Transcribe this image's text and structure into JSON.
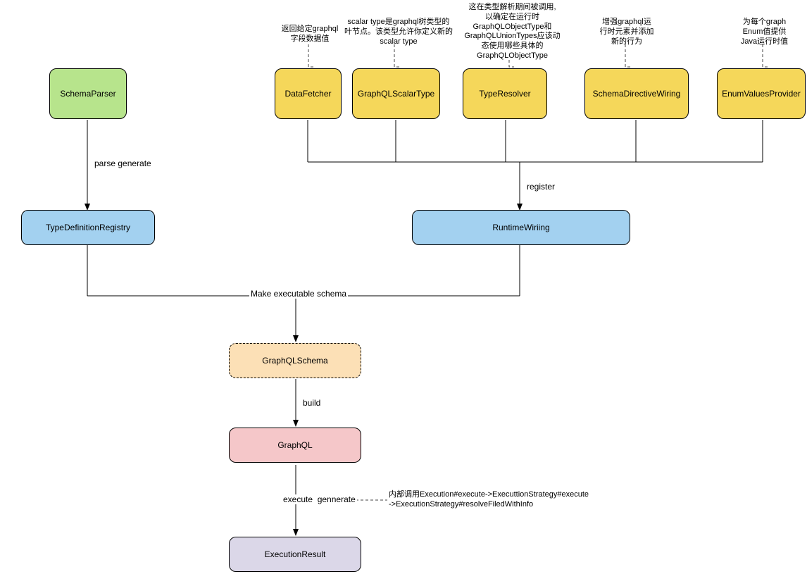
{
  "nodes": {
    "schemaParser": "SchemaParser",
    "dataFetcher": "DataFetcher",
    "graphqlScalarType": "GraphQLScalarType",
    "typeResolver": "TypeResolver",
    "schemaDirectiveWiring": "SchemaDirectiveWiring",
    "enumValuesProvider": "EnumValuesProvider",
    "typeDefinitionRegistry": "TypeDefinitionRegistry",
    "runtimeWiring": "RuntimeWiriing",
    "graphqlSchema": "GraphQLSchema",
    "graphql": "GraphQL",
    "executionResult": "ExecutionResult"
  },
  "annotations": {
    "dataFetcher": "返回给定graphql\n字段数据值",
    "graphqlScalarType": "scalar type是graphql树类型的\n叶节点。该类型允许你定义新的\nscalar type",
    "typeResolver": "这在类型解析期间被调用,\n以确定在运行时\nGraphQLObjectType和\nGraphQLUnionTypes应该动\n态使用哪些具体的\nGraphQLObjectType",
    "schemaDirectiveWiring": "增强graphql运\n行时元素并添加\n新的行为",
    "enumValuesProvider": "为每个graph\nEnum值提供\nJava运行时值",
    "executeNote": "内部调用Execution#execute->ExecuttionStrategy#execute\n->ExecutionStrategy#resolveFiledWithInfo"
  },
  "edgeLabels": {
    "parseGenerate": "parse generate",
    "register": "register",
    "makeExecutable": "Make executable schema",
    "build": "build",
    "executeGenerate": "execute  gennerate"
  }
}
